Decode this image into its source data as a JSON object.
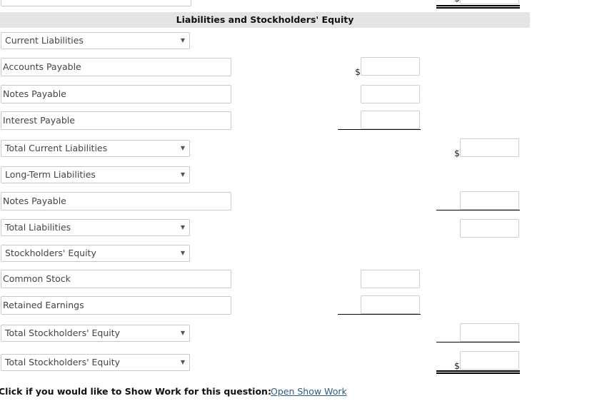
{
  "section_header": "Liabilities and Stockholders' Equity",
  "rows": [
    {
      "kind": "select",
      "label": "Current Liabilities"
    },
    {
      "kind": "text",
      "value": "Accounts Payable"
    },
    {
      "kind": "text",
      "value": "Notes Payable"
    },
    {
      "kind": "text",
      "value": "Interest Payable"
    },
    {
      "kind": "select",
      "label": "Total Current Liabilities"
    },
    {
      "kind": "select",
      "label": "Long-Term Liabilities"
    },
    {
      "kind": "text",
      "value": "Notes Payable"
    },
    {
      "kind": "select",
      "label": "Total Liabilities"
    },
    {
      "kind": "select",
      "label": "Stockholders' Equity"
    },
    {
      "kind": "text",
      "value": "Common Stock"
    },
    {
      "kind": "text",
      "value": "Retained Earnings"
    },
    {
      "kind": "select",
      "label": "Total Stockholders' Equity"
    },
    {
      "kind": "select",
      "label": "Total Stockholders' Equity"
    }
  ],
  "currency_symbol": "$",
  "amounts": {
    "accounts_payable": "",
    "notes_payable_current": "",
    "interest_payable": "",
    "total_current_liabilities": "",
    "notes_payable_long_term": "",
    "total_liabilities": "",
    "common_stock": "",
    "retained_earnings": "",
    "total_stockholders_equity": "",
    "total_liabilities_and_equity": "",
    "previous_total": ""
  },
  "footer": {
    "prompt": "Click if you would like to Show Work for this question:",
    "link": "Open Show Work"
  }
}
